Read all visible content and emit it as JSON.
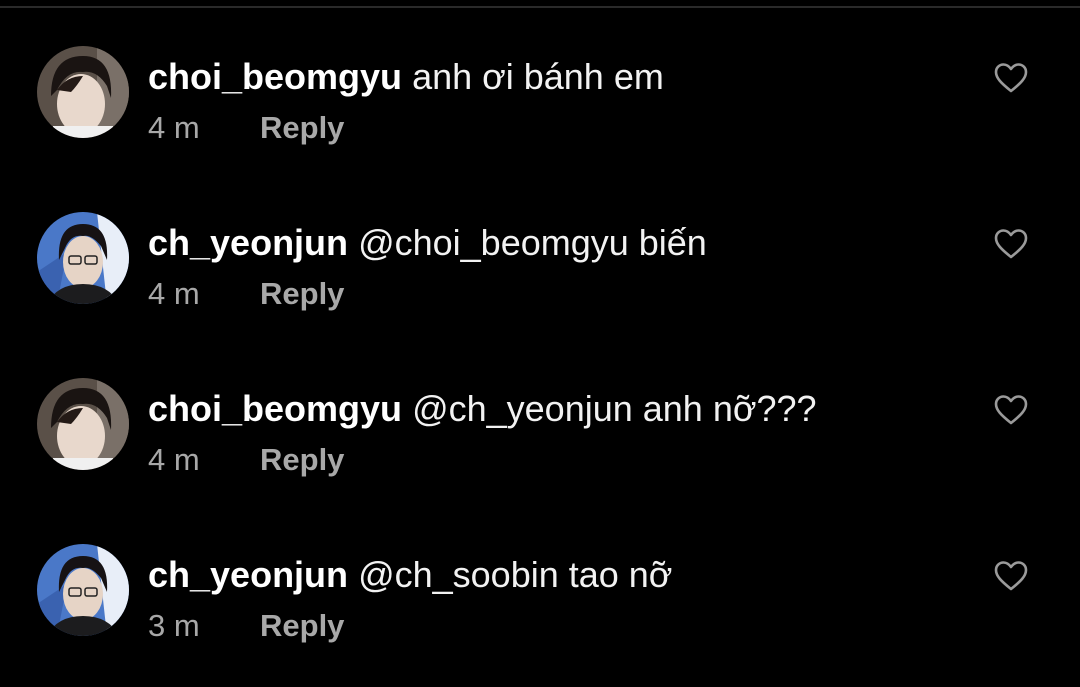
{
  "colors": {
    "background": "#000000",
    "text": "#f2f2f2",
    "muted": "#a8a8a8",
    "divider": "#2a2a2a"
  },
  "comments": [
    {
      "username": "choi_beomgyu",
      "text": "anh ơi bánh em",
      "time": "4 m",
      "reply_label": "Reply",
      "avatar": "user-avatar-photo",
      "like_icon": "heart-outline-icon"
    },
    {
      "username": "ch_yeonjun",
      "text": "@choi_beomgyu biến",
      "time": "4 m",
      "reply_label": "Reply",
      "avatar": "user-avatar-photo",
      "like_icon": "heart-outline-icon"
    },
    {
      "username": "choi_beomgyu",
      "text": "@ch_yeonjun anh nỡ???",
      "time": "4 m",
      "reply_label": "Reply",
      "avatar": "user-avatar-photo",
      "like_icon": "heart-outline-icon"
    },
    {
      "username": "ch_yeonjun",
      "text": "@ch_soobin tao nỡ",
      "time": "3 m",
      "reply_label": "Reply",
      "avatar": "user-avatar-photo",
      "like_icon": "heart-outline-icon"
    }
  ]
}
